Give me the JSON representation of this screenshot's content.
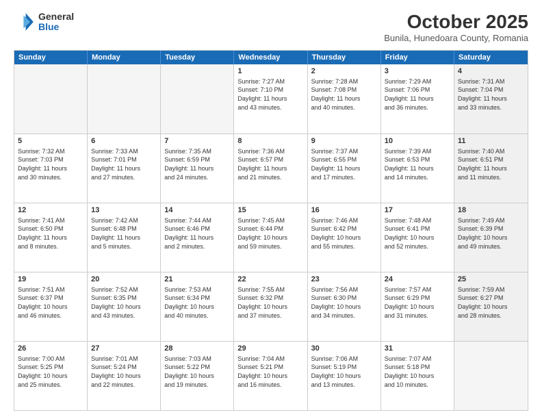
{
  "header": {
    "logo": {
      "general": "General",
      "blue": "Blue"
    },
    "title": "October 2025",
    "location": "Bunila, Hunedoara County, Romania"
  },
  "calendar": {
    "days_of_week": [
      "Sunday",
      "Monday",
      "Tuesday",
      "Wednesday",
      "Thursday",
      "Friday",
      "Saturday"
    ],
    "weeks": [
      [
        {
          "day": "",
          "info": "",
          "empty": true
        },
        {
          "day": "",
          "info": "",
          "empty": true
        },
        {
          "day": "",
          "info": "",
          "empty": true
        },
        {
          "day": "1",
          "info": "Sunrise: 7:27 AM\nSunset: 7:10 PM\nDaylight: 11 hours\nand 43 minutes."
        },
        {
          "day": "2",
          "info": "Sunrise: 7:28 AM\nSunset: 7:08 PM\nDaylight: 11 hours\nand 40 minutes."
        },
        {
          "day": "3",
          "info": "Sunrise: 7:29 AM\nSunset: 7:06 PM\nDaylight: 11 hours\nand 36 minutes."
        },
        {
          "day": "4",
          "info": "Sunrise: 7:31 AM\nSunset: 7:04 PM\nDaylight: 11 hours\nand 33 minutes.",
          "shaded": true
        }
      ],
      [
        {
          "day": "5",
          "info": "Sunrise: 7:32 AM\nSunset: 7:03 PM\nDaylight: 11 hours\nand 30 minutes."
        },
        {
          "day": "6",
          "info": "Sunrise: 7:33 AM\nSunset: 7:01 PM\nDaylight: 11 hours\nand 27 minutes."
        },
        {
          "day": "7",
          "info": "Sunrise: 7:35 AM\nSunset: 6:59 PM\nDaylight: 11 hours\nand 24 minutes."
        },
        {
          "day": "8",
          "info": "Sunrise: 7:36 AM\nSunset: 6:57 PM\nDaylight: 11 hours\nand 21 minutes."
        },
        {
          "day": "9",
          "info": "Sunrise: 7:37 AM\nSunset: 6:55 PM\nDaylight: 11 hours\nand 17 minutes."
        },
        {
          "day": "10",
          "info": "Sunrise: 7:39 AM\nSunset: 6:53 PM\nDaylight: 11 hours\nand 14 minutes."
        },
        {
          "day": "11",
          "info": "Sunrise: 7:40 AM\nSunset: 6:51 PM\nDaylight: 11 hours\nand 11 minutes.",
          "shaded": true
        }
      ],
      [
        {
          "day": "12",
          "info": "Sunrise: 7:41 AM\nSunset: 6:50 PM\nDaylight: 11 hours\nand 8 minutes."
        },
        {
          "day": "13",
          "info": "Sunrise: 7:42 AM\nSunset: 6:48 PM\nDaylight: 11 hours\nand 5 minutes."
        },
        {
          "day": "14",
          "info": "Sunrise: 7:44 AM\nSunset: 6:46 PM\nDaylight: 11 hours\nand 2 minutes."
        },
        {
          "day": "15",
          "info": "Sunrise: 7:45 AM\nSunset: 6:44 PM\nDaylight: 10 hours\nand 59 minutes."
        },
        {
          "day": "16",
          "info": "Sunrise: 7:46 AM\nSunset: 6:42 PM\nDaylight: 10 hours\nand 55 minutes."
        },
        {
          "day": "17",
          "info": "Sunrise: 7:48 AM\nSunset: 6:41 PM\nDaylight: 10 hours\nand 52 minutes."
        },
        {
          "day": "18",
          "info": "Sunrise: 7:49 AM\nSunset: 6:39 PM\nDaylight: 10 hours\nand 49 minutes.",
          "shaded": true
        }
      ],
      [
        {
          "day": "19",
          "info": "Sunrise: 7:51 AM\nSunset: 6:37 PM\nDaylight: 10 hours\nand 46 minutes."
        },
        {
          "day": "20",
          "info": "Sunrise: 7:52 AM\nSunset: 6:35 PM\nDaylight: 10 hours\nand 43 minutes."
        },
        {
          "day": "21",
          "info": "Sunrise: 7:53 AM\nSunset: 6:34 PM\nDaylight: 10 hours\nand 40 minutes."
        },
        {
          "day": "22",
          "info": "Sunrise: 7:55 AM\nSunset: 6:32 PM\nDaylight: 10 hours\nand 37 minutes."
        },
        {
          "day": "23",
          "info": "Sunrise: 7:56 AM\nSunset: 6:30 PM\nDaylight: 10 hours\nand 34 minutes."
        },
        {
          "day": "24",
          "info": "Sunrise: 7:57 AM\nSunset: 6:29 PM\nDaylight: 10 hours\nand 31 minutes."
        },
        {
          "day": "25",
          "info": "Sunrise: 7:59 AM\nSunset: 6:27 PM\nDaylight: 10 hours\nand 28 minutes.",
          "shaded": true
        }
      ],
      [
        {
          "day": "26",
          "info": "Sunrise: 7:00 AM\nSunset: 5:25 PM\nDaylight: 10 hours\nand 25 minutes."
        },
        {
          "day": "27",
          "info": "Sunrise: 7:01 AM\nSunset: 5:24 PM\nDaylight: 10 hours\nand 22 minutes."
        },
        {
          "day": "28",
          "info": "Sunrise: 7:03 AM\nSunset: 5:22 PM\nDaylight: 10 hours\nand 19 minutes."
        },
        {
          "day": "29",
          "info": "Sunrise: 7:04 AM\nSunset: 5:21 PM\nDaylight: 10 hours\nand 16 minutes."
        },
        {
          "day": "30",
          "info": "Sunrise: 7:06 AM\nSunset: 5:19 PM\nDaylight: 10 hours\nand 13 minutes."
        },
        {
          "day": "31",
          "info": "Sunrise: 7:07 AM\nSunset: 5:18 PM\nDaylight: 10 hours\nand 10 minutes."
        },
        {
          "day": "",
          "info": "",
          "empty": true,
          "shaded": true
        }
      ]
    ]
  }
}
